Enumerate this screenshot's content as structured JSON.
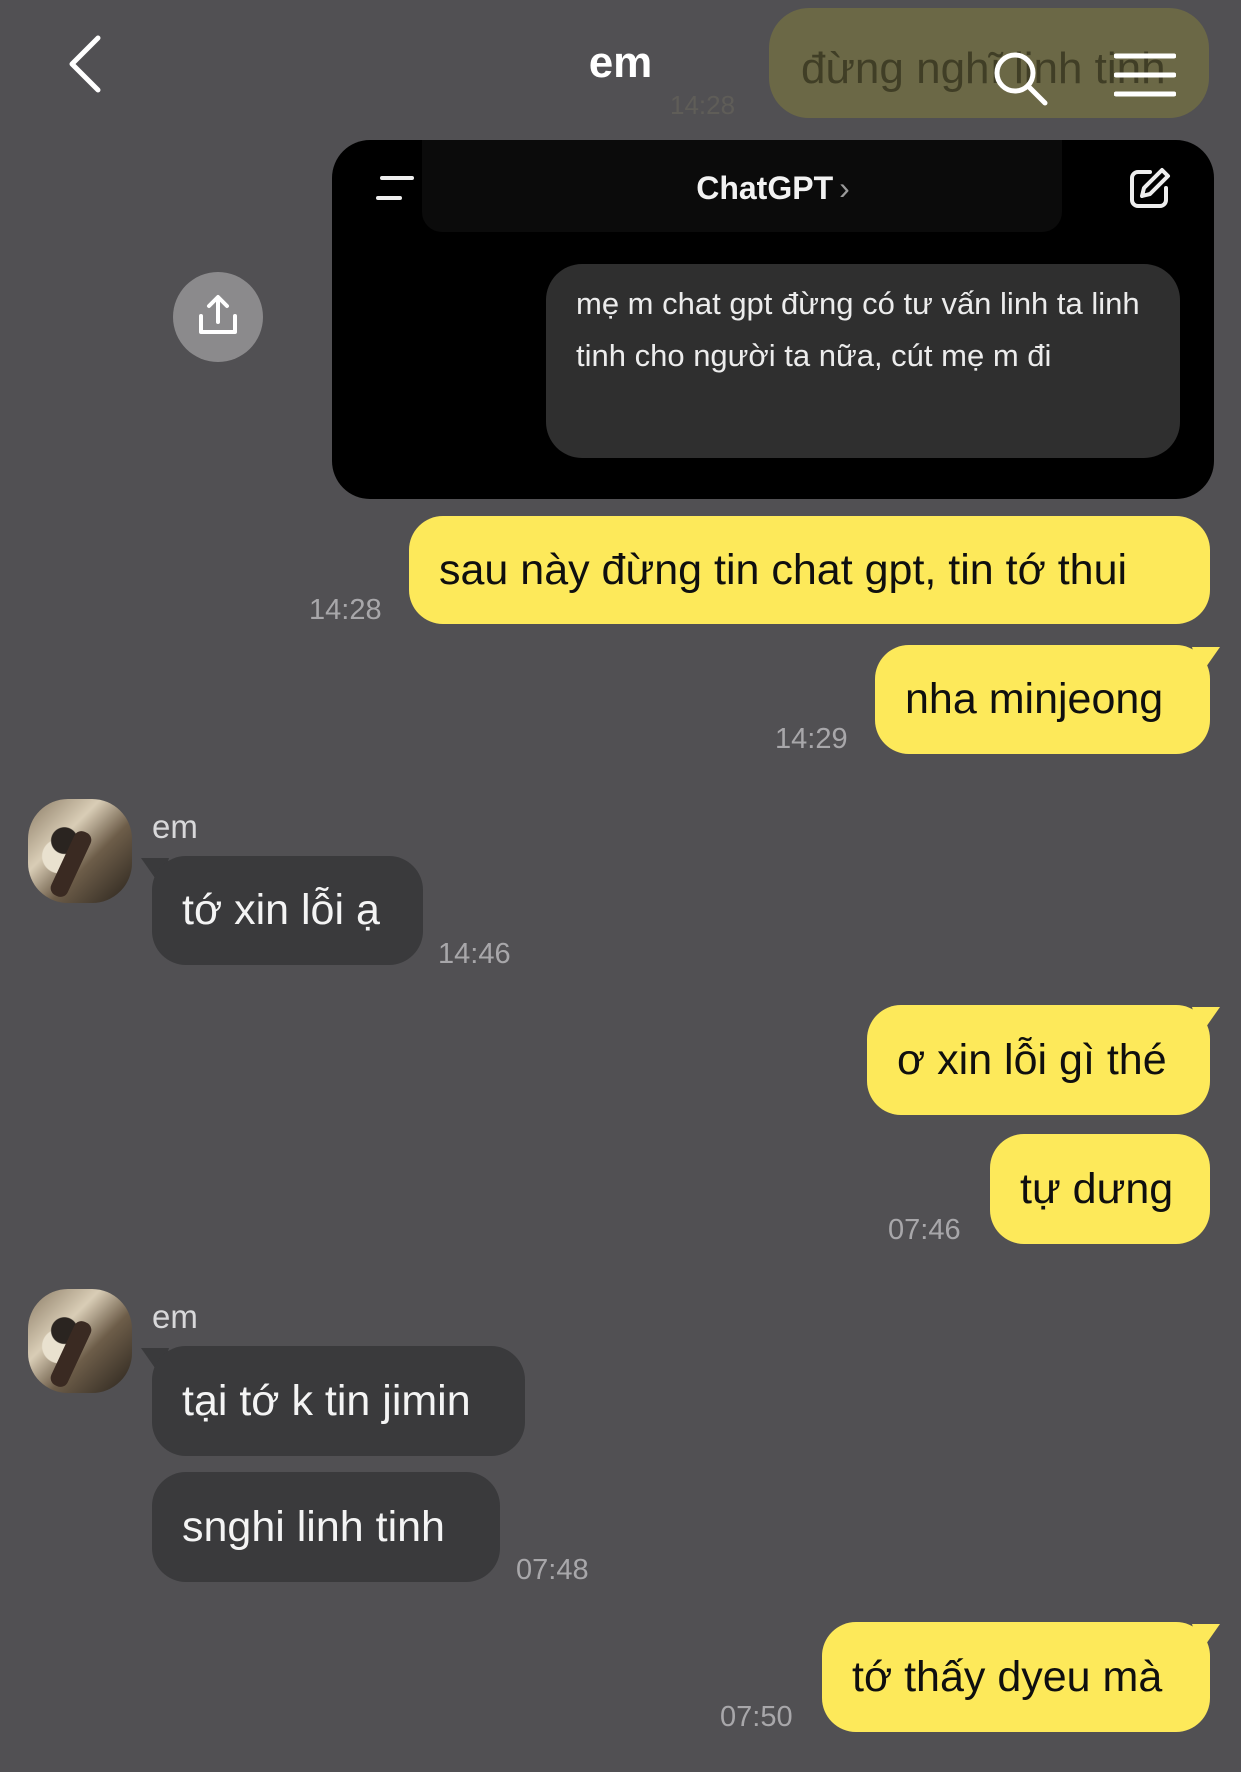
{
  "header": {
    "title": "em",
    "ghost_message": "đừng nghĩ linh tinh",
    "ghost_time": "14:28"
  },
  "shared_image": {
    "app_title": "ChatGPT",
    "app_title_chevron": "›",
    "message": "mẹ m chat gpt đừng có tư vấn linh ta linh tinh cho người ta nữa, cút mẹ m đi"
  },
  "messages": [
    {
      "text": "sau này đừng tin chat gpt, tin tớ thui",
      "time": "14:28"
    },
    {
      "text": "nha minjeong",
      "time": "14:29"
    },
    {
      "sender": "em",
      "text": "tớ xin lỗi ạ",
      "time": "14:46"
    },
    {
      "text": "ơ xin lỗi gì thé"
    },
    {
      "text": "tự dưng",
      "time": "07:46"
    },
    {
      "sender": "em",
      "text": "tại tớ k tin jimin"
    },
    {
      "text": "snghi linh tinh",
      "time": "07:48"
    },
    {
      "text": "tớ thấy dyeu mà",
      "time": "07:50"
    }
  ],
  "colors": {
    "background": "#515053",
    "outgoing_bubble": "#fde95a",
    "incoming_bubble": "#3a3a3c"
  },
  "icons": [
    "back-icon",
    "search-icon",
    "menu-icon",
    "share-icon",
    "sidebar-icon",
    "edit-icon"
  ]
}
